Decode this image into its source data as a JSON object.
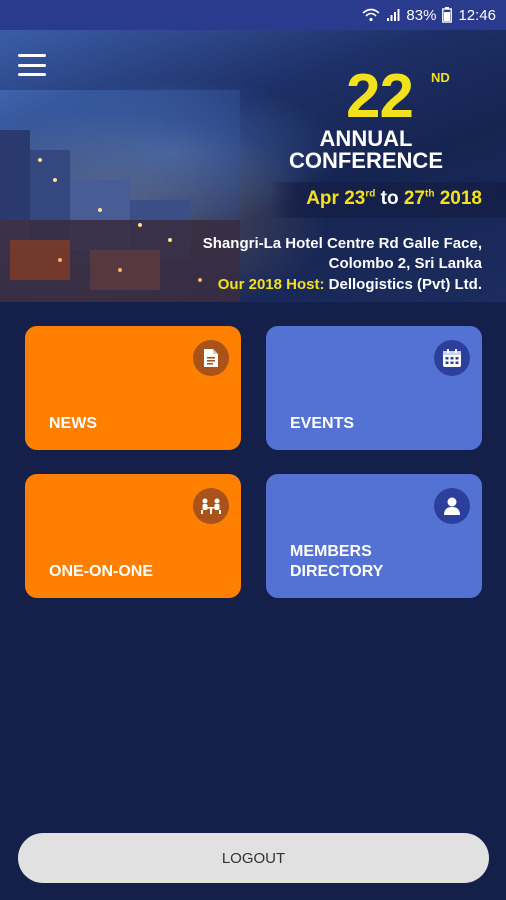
{
  "status_bar": {
    "battery": "83%",
    "time": "12:46"
  },
  "banner": {
    "number": "22",
    "ordinal": "ND",
    "title_line1": "ANNUAL",
    "title_line2": "CONFERENCE",
    "date_start": "Apr 23",
    "date_start_suffix": "rd",
    "date_to": "to",
    "date_end": "27",
    "date_end_suffix": "th",
    "date_year": "2018",
    "venue_line1": "Shangri-La Hotel Centre Rd Galle Face,",
    "venue_line2": "Colombo 2, Sri Lanka",
    "host_label": "Our 2018 Host:",
    "host_name": "Dellogistics (Pvt) Ltd."
  },
  "tiles": [
    {
      "label": "NEWS",
      "icon": "document-icon"
    },
    {
      "label": "EVENTS",
      "icon": "calendar-icon"
    },
    {
      "label": "ONE-ON-ONE",
      "icon": "meeting-icon"
    },
    {
      "label_line1": "MEMBERS",
      "label_line2": "DIRECTORY",
      "icon": "person-icon"
    }
  ],
  "logout": {
    "label": "LOGOUT"
  },
  "colors": {
    "background": "#15204a",
    "status_bar": "#2a3a8c",
    "accent_yellow": "#f2e11d",
    "tile_orange": "#ff7f00",
    "tile_blue": "#5472d3"
  }
}
